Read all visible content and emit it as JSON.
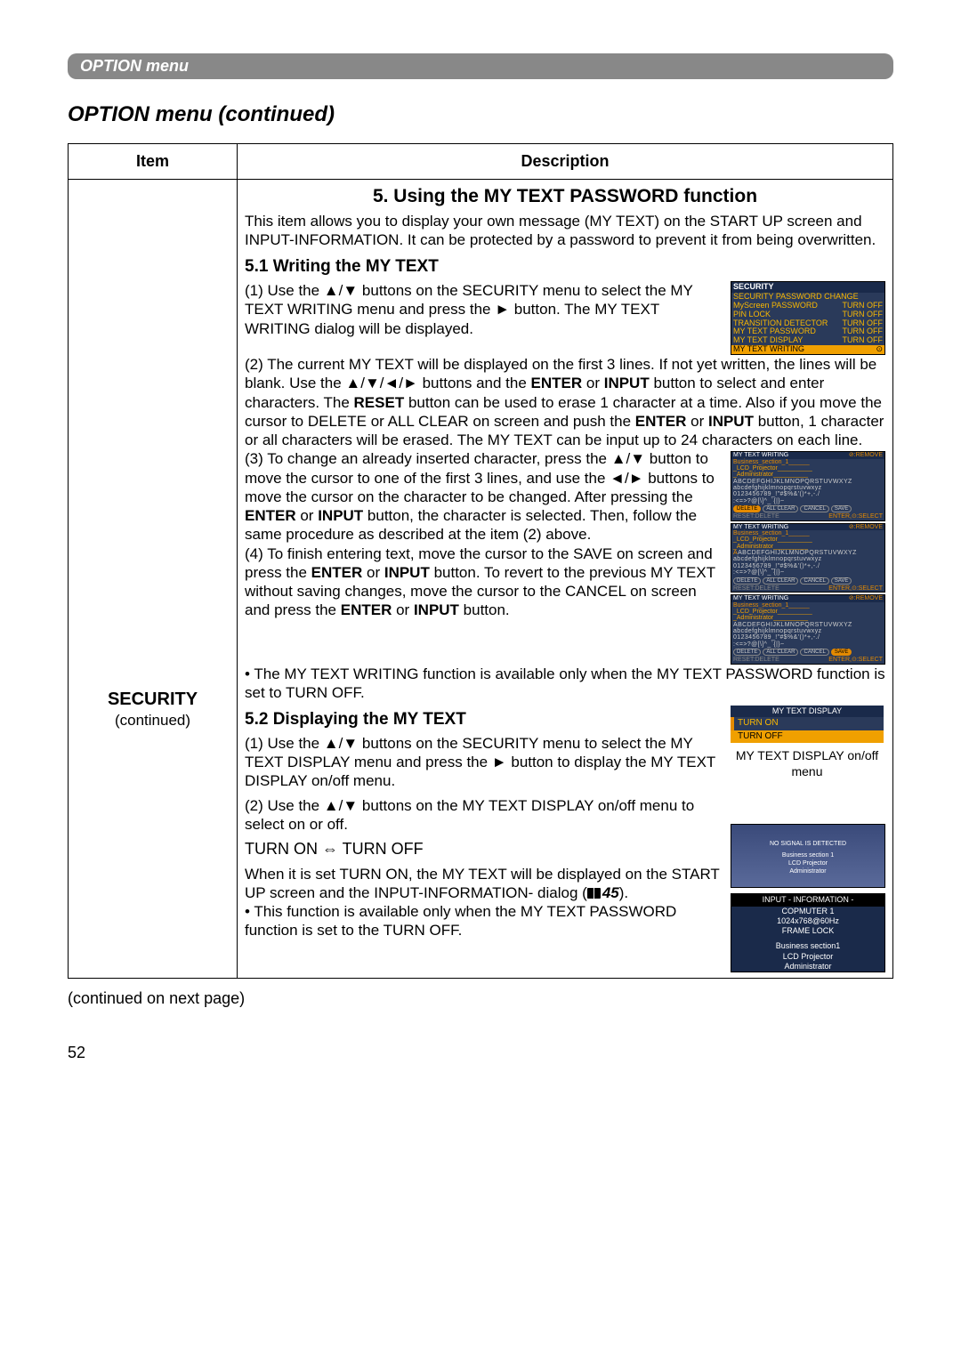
{
  "header": "OPTION menu",
  "section_title": "OPTION menu (continued)",
  "table": {
    "head_item": "Item",
    "head_desc": "Description",
    "side_ttl": "SECURITY",
    "side_sub": "(continued)"
  },
  "desc": {
    "h1": "5. Using the MY TEXT PASSWORD function",
    "intro": "This item allows you to display your own message (MY TEXT) on the START UP screen and INPUT-INFORMATION. It can be protected by a password to prevent it from being overwritten.",
    "h2_1": "5.1 Writing the MY TEXT",
    "p1a": "(1) Use the ▲/▼ buttons on the SECURITY menu to select the MY TEXT WRITING menu and press the ► button. The MY TEXT WRITING dialog will be displayed.",
    "p2_pre": "(2) The current MY TEXT will be displayed on the first 3 lines. If not yet written, the lines will be blank. Use the ▲/▼/◄/► buttons and the ",
    "p2_b1": "ENTER",
    "p2_mid1": " or ",
    "p2_b2": "INPUT",
    "p2_mid2": " button to select and enter characters. The ",
    "p2_b3": "RESET",
    "p2_mid3": " button can be used to erase 1 character at a time. Also if you move the cursor to DELETE or ALL CLEAR on screen and push the ",
    "p2_b4": "ENTER",
    "p2_mid4": " or ",
    "p2_b5": "INPUT",
    "p2_end": " button, 1 character or all characters will be erased. The MY TEXT can be input up to 24 characters on each line.",
    "p3_pre": "(3) To change an already inserted character, press the ▲/▼ button to move the cursor to one of the first 3 lines, and use the ◄/► buttons to move the cursor on the character to be changed. After pressing the ",
    "p3_b1": "ENTER",
    "p3_mid1": " or ",
    "p3_b2": "INPUT",
    "p3_end": " button, the character is selected. Then, follow the same procedure as described at the item (2) above.",
    "p4_pre": "(4) To finish entering text, move the cursor to the SAVE on screen and press the ",
    "p4_b1": "ENTER",
    "p4_mid1": " or ",
    "p4_b2": "INPUT",
    "p4_mid2": " button. To revert to the previous MY TEXT without saving changes, move the cursor to the CANCEL on screen and press the ",
    "p4_b3": "ENTER",
    "p4_mid3": " or ",
    "p4_b4": "INPUT",
    "p4_end": " button.",
    "note1": "• The MY TEXT WRITING function is available only when the MY TEXT PASSWORD function is set to TURN OFF.",
    "h2_2": "5.2 Displaying the MY TEXT",
    "p5": "(1) Use the ▲/▼ buttons on the SECURITY menu to select the MY TEXT DISPLAY menu and press the ► button to display the MY TEXT DISPLAY on/off menu.",
    "p6": "(2) Use the ▲/▼ buttons on the MY TEXT DISPLAY on/off menu to select on or off.",
    "turn": "TURN ON ⇔ TURN OFF",
    "p7_pre": "When it is set TURN ON, the MY TEXT will be displayed on the START UP screen and the INPUT-INFORMATION- dialog (",
    "p7_ref": "45",
    "p7_end": ").",
    "note2": "• This function is available only when the MY TEXT PASSWORD function is set to the TURN OFF."
  },
  "menu1": {
    "title": "SECURITY",
    "rows": [
      [
        "SECURITY PASSWORD CHANGE",
        ""
      ],
      [
        "MyScreen PASSWORD",
        "TURN OFF"
      ],
      [
        "PIN LOCK",
        "TURN OFF"
      ],
      [
        "TRANSITION DETECTOR",
        "TURN OFF"
      ],
      [
        "MY TEXT PASSWORD",
        "TURN OFF"
      ],
      [
        "MY TEXT DISPLAY",
        "TURN OFF"
      ]
    ],
    "sel": "MY TEXT WRITING"
  },
  "writer": {
    "hdr_l": "MY TEXT WRITING",
    "hdr_r": "⊘:REMOVE",
    "lines": [
      "Business_section_1______",
      "_LCD_Projector__________",
      "_Administrator__________"
    ],
    "chars": [
      "ABCDEFGHIJKLMNOPQRSTUVWXYZ",
      "abcdefghijklmnopqrstuvwxyz",
      "0123456789_!\"#$%&'()*+,-./",
      ":<=>?@[\\]^_`{|}~"
    ],
    "btns": [
      "DELETE",
      "ALL CLEAR",
      "CANCEL",
      "SAVE"
    ],
    "foot_l": "RESET:DELETE",
    "foot_r": "ENTER,⊙:SELECT"
  },
  "mtdisp": {
    "hdr": "MY TEXT DISPLAY",
    "on": "TURN ON",
    "off": "TURN OFF",
    "cap": "MY TEXT DISPLAY on/off menu"
  },
  "startup": {
    "l1": "NO SIGNAL IS DETECTED",
    "l2": "Business section 1",
    "l3": "LCD Projector",
    "l4": "Administrator"
  },
  "infobox": {
    "hdr": "INPUT - INFORMATION -",
    "rows": [
      "COPMUTER 1",
      "1024x768@60Hz",
      "FRAME LOCK",
      "",
      "Business section1",
      "LCD Projector",
      "Administrator"
    ]
  },
  "continued": "(continued on next page)",
  "page": "52"
}
